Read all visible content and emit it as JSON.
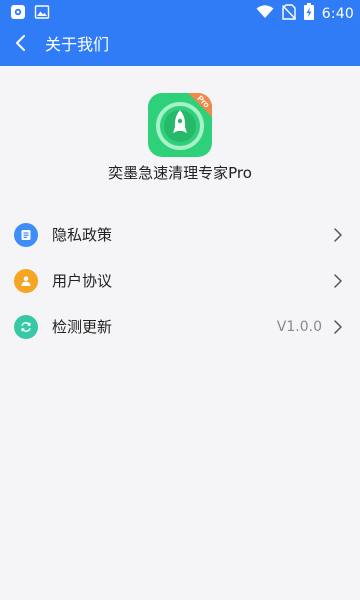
{
  "status_bar": {
    "time": "6:40",
    "icons": [
      "settings-notification-icon",
      "gallery-notification-icon",
      "wifi-icon",
      "no-sim-icon",
      "battery-charging-icon"
    ]
  },
  "app_bar": {
    "title": "关于我们",
    "back_icon": "back-arrow-icon"
  },
  "app": {
    "name": "奕墨急速清理专家Pro",
    "logo_badge": "Pro"
  },
  "menu": {
    "items": [
      {
        "label": "隐私政策",
        "value": "",
        "icon": "document-icon",
        "icon_color": "#3f8ef8"
      },
      {
        "label": "用户协议",
        "value": "",
        "icon": "user-icon",
        "icon_color": "#f5a623"
      },
      {
        "label": "检测更新",
        "value": "V1.0.0",
        "icon": "refresh-icon",
        "icon_color": "#37c8a6"
      }
    ]
  },
  "colors": {
    "primary": "#2f7cf6",
    "background": "#f5f5f7",
    "logo_green": "#2fd07a"
  }
}
